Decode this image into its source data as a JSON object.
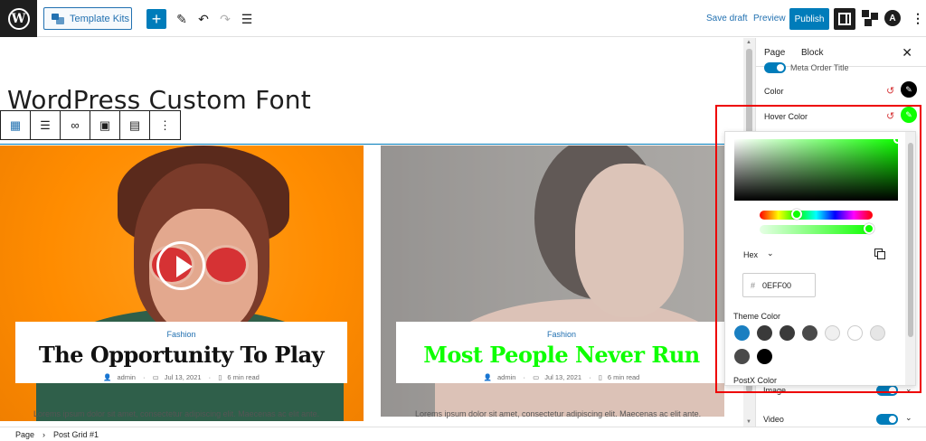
{
  "topbar": {
    "template_kits_label": "Template Kits",
    "save_draft_label": "Save draft",
    "preview_label": "Preview",
    "publish_label": "Publish",
    "astra_glyph": "A",
    "wp_glyph": "W",
    "plus_glyph": "+",
    "edit_glyph": "✎",
    "undo_glyph": "↶",
    "redo_glyph": "↷",
    "outline_glyph": "☰",
    "kebab_glyph": "⋮"
  },
  "page": {
    "title": "WordPress Custom Font"
  },
  "block_toolbar": {
    "icons": [
      "post-grid-icon",
      "align-icon",
      "link-icon",
      "image-icon",
      "layout-icon",
      "more-options-icon"
    ],
    "glyphs": [
      "▦",
      "☰",
      "∞",
      "▣",
      "▤",
      "⋮"
    ]
  },
  "posts": [
    {
      "category": "Fashion",
      "title": "The Opportunity To Play",
      "author": "admin",
      "date": "Jul 13, 2021",
      "read_time": "6 min read",
      "excerpt": "Lorems ipsum dolor sit amet, consectetur adipiscing elit. Maecenas ac elit ante.",
      "title_color": "#111111"
    },
    {
      "category": "Fashion",
      "title": "Most People Never Run",
      "author": "admin",
      "date": "Jul 13, 2021",
      "read_time": "6 min read",
      "excerpt": "Lorems ipsum dolor sit amet, consectetur adipiscing elit. Maecenas ac elit ante.",
      "title_color": "#0eff00"
    }
  ],
  "sidebar": {
    "tab_page": "Page",
    "tab_block": "Block",
    "close_glyph": "✕",
    "meta_order_title": "Meta Order Title",
    "color_label": "Color",
    "hover_color_label": "Hover Color",
    "image_label": "Image",
    "video_label": "Video",
    "reset_glyph": "↺",
    "pen_glyph": "✎",
    "chevron_glyph": "⌄"
  },
  "color_picker": {
    "format_label": "Hex",
    "hex_hash": "#",
    "hex_value": "0EFF00",
    "theme_color_label": "Theme Color",
    "postx_color_label": "PostX Color",
    "current_color": "#0eff00",
    "theme_colors": [
      "#1a7fc1",
      "#3a3a3a",
      "#3a3a3a",
      "#4a4a4a",
      "#f0f0f0",
      "#ffffff",
      "#e6e6e6",
      "#4a4a4a",
      "#000000"
    ]
  },
  "footer": {
    "breadcrumb_page": "Page",
    "breadcrumb_separator": "›",
    "breadcrumb_block": "Post Grid #1"
  },
  "colors": {
    "accent": "#007cba",
    "highlight_border": "#ee0000"
  }
}
